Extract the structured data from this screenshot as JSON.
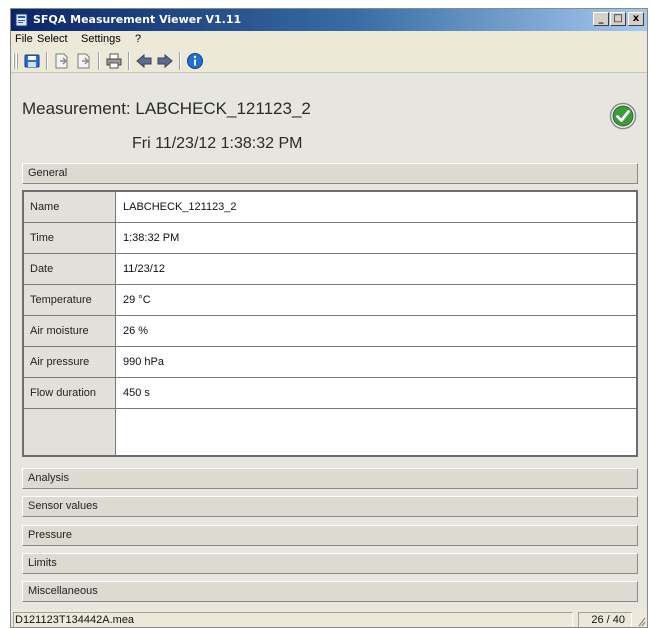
{
  "window": {
    "title": "SFQA Measurement Viewer V1.11",
    "caption_buttons": [
      "_",
      "□",
      "x"
    ]
  },
  "menu": [
    "File",
    "Select",
    "Settings",
    "?"
  ],
  "toolbar": {
    "buttons": [
      "save-icon",
      "export-icon",
      "export-all-icon",
      "print-icon",
      "arrow-left-icon",
      "arrow-right-icon",
      "info-icon"
    ]
  },
  "measurement": {
    "title": "Measurement: LABCHECK_121123_2",
    "datetime": "Fri  11/23/12  1:38:32 PM",
    "status_icon": "check-icon",
    "status_color": "#2e8b2e"
  },
  "sections": {
    "general": "General",
    "analysis": "Analysis",
    "sensor_values": "Sensor values",
    "pressure": "Pressure",
    "limits": "Limits",
    "miscellaneous": "Miscellaneous"
  },
  "general_table": [
    {
      "label": "Name",
      "value": "LABCHECK_121123_2"
    },
    {
      "label": "Time",
      "value": "1:38:32 PM"
    },
    {
      "label": "Date",
      "value": "11/23/12"
    },
    {
      "label": "Temperature",
      "value": "29 °C"
    },
    {
      "label": "Air moisture",
      "value": "26 %"
    },
    {
      "label": "Air pressure",
      "value": "990 hPa"
    },
    {
      "label": "Flow duration",
      "value": "450 s"
    }
  ],
  "status": {
    "file": "D121123T134442A.mea",
    "count": "26 / 40"
  }
}
